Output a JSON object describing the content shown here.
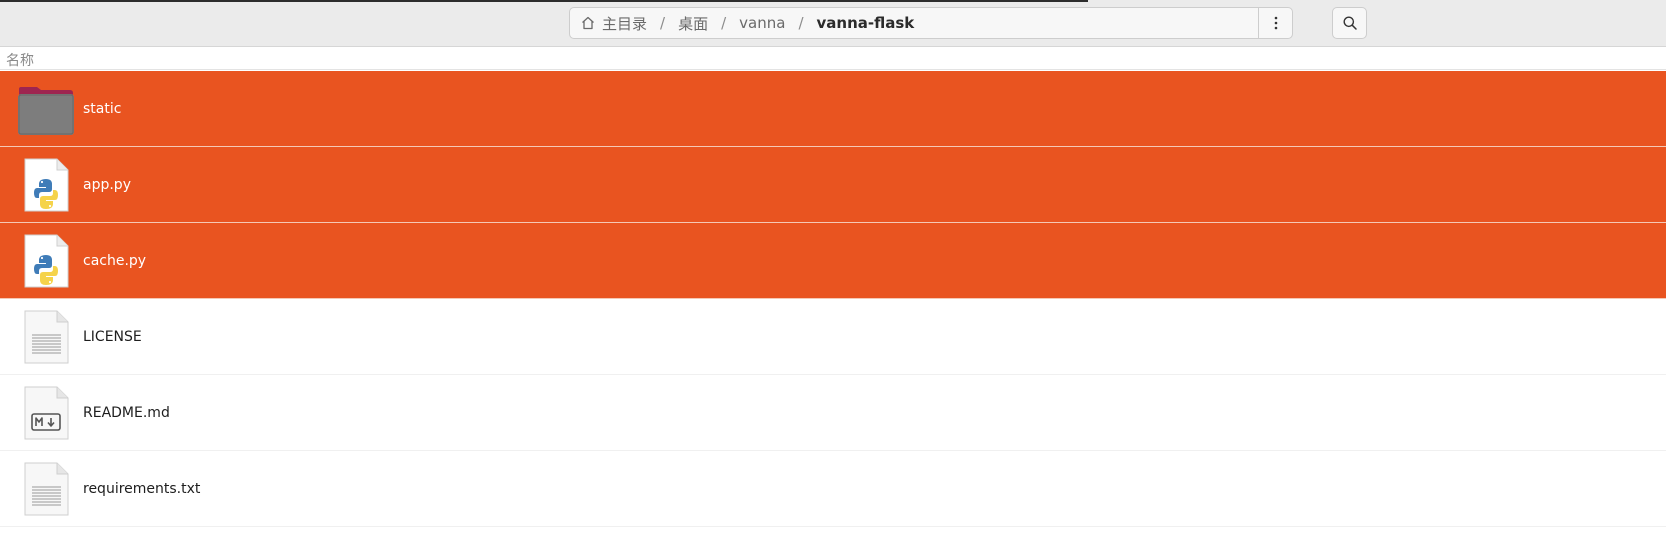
{
  "breadcrumb": [
    "主目录",
    "桌面",
    "vanna",
    "vanna-flask"
  ],
  "column_header": "名称",
  "files": [
    {
      "name": "static",
      "icon": "folder-icon",
      "selected": true
    },
    {
      "name": "app.py",
      "icon": "python-file-icon",
      "selected": true
    },
    {
      "name": "cache.py",
      "icon": "python-file-icon",
      "selected": true
    },
    {
      "name": "LICENSE",
      "icon": "text-file-icon",
      "selected": false
    },
    {
      "name": "README.md",
      "icon": "markdown-file-icon",
      "selected": false
    },
    {
      "name": "requirements.txt",
      "icon": "text-file-icon",
      "selected": false
    }
  ],
  "colors": {
    "selection": "#e95420",
    "header_bg": "#ebebeb"
  }
}
